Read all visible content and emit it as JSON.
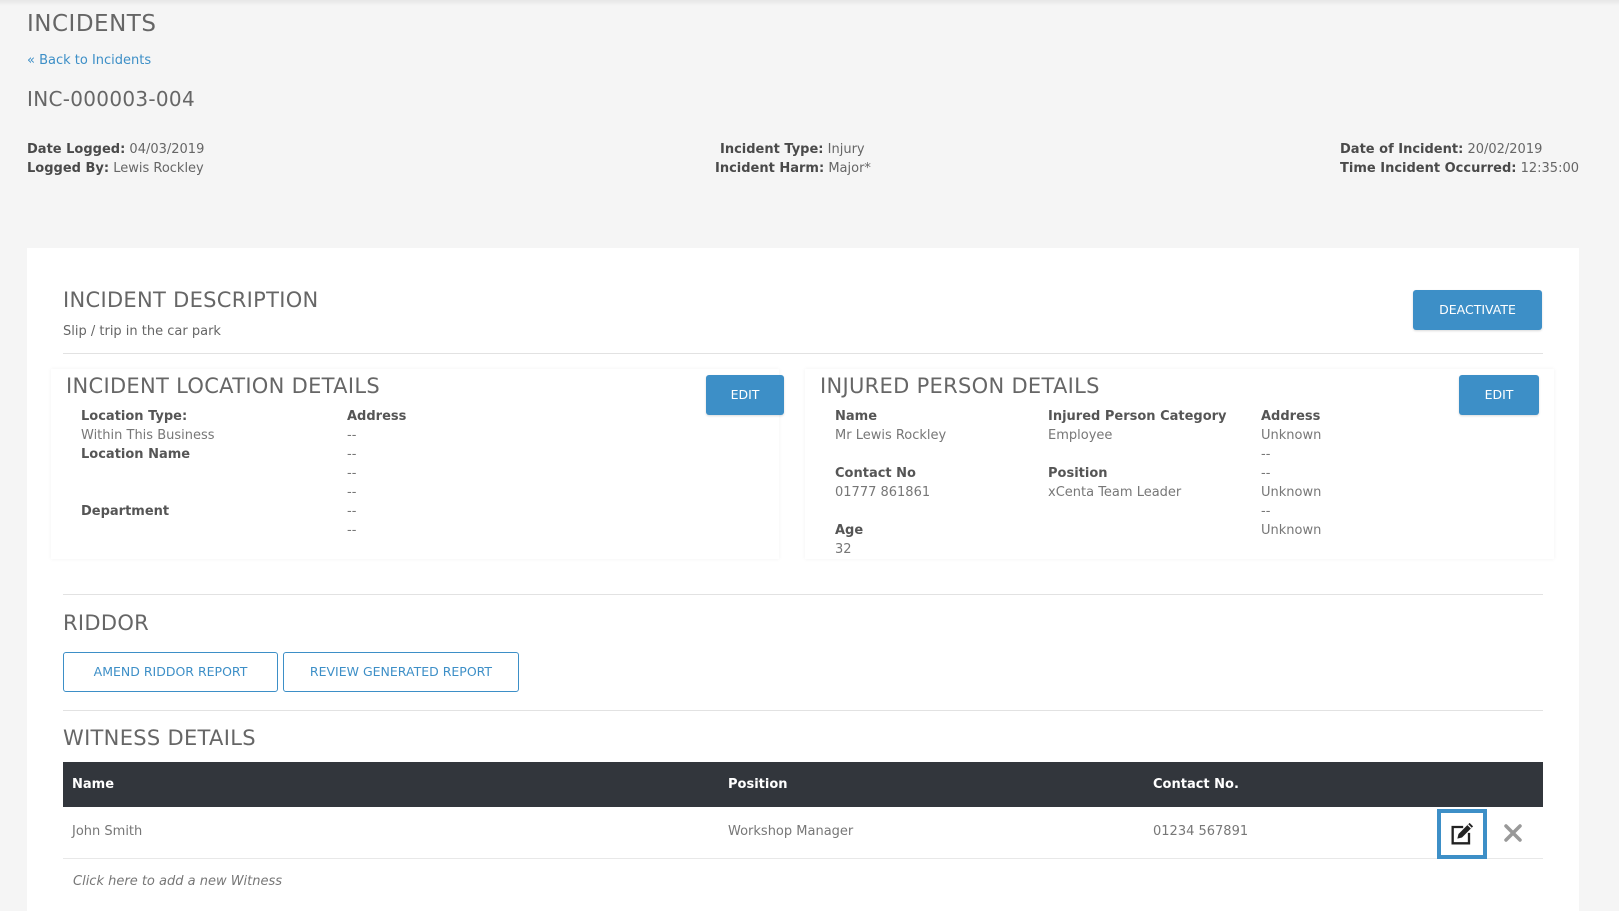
{
  "page": {
    "title": "INCIDENTS",
    "back_link": "« Back to Incidents",
    "incident_id": "INC-000003-004"
  },
  "meta": {
    "date_logged_label": "Date Logged:",
    "date_logged": "04/03/2019",
    "logged_by_label": "Logged By:",
    "logged_by": "Lewis Rockley",
    "incident_type_label": "Incident Type:",
    "incident_type": "Injury",
    "incident_harm_label": "Incident Harm:",
    "incident_harm": "Major*",
    "date_of_incident_label": "Date of Incident:",
    "date_of_incident": "20/02/2019",
    "time_occurred_label": "Time Incident Occurred:",
    "time_occurred": "12:35:00"
  },
  "description": {
    "heading": "INCIDENT DESCRIPTION",
    "text": "Slip / trip in the car park",
    "deactivate_label": "DEACTIVATE"
  },
  "location": {
    "heading": "INCIDENT LOCATION DETAILS",
    "edit_label": "EDIT",
    "location_type_label": "Location Type:",
    "location_type": "Within This Business",
    "location_name_label": "Location Name",
    "department_label": "Department",
    "address_label": "Address",
    "address_lines": [
      "--",
      "--",
      "--",
      "--",
      "--",
      "--"
    ]
  },
  "injured": {
    "heading": "INJURED PERSON DETAILS",
    "edit_label": "EDIT",
    "name_label": "Name",
    "name": "Mr Lewis Rockley",
    "contact_label": "Contact No",
    "contact": "01777 861861",
    "age_label": "Age",
    "age": "32",
    "category_label": "Injured Person Category",
    "category": "Employee",
    "position_label": "Position",
    "position": "xCenta Team Leader",
    "address_label": "Address",
    "address_lines": [
      "Unknown",
      "--",
      "--",
      "Unknown",
      "--",
      "Unknown"
    ]
  },
  "riddor": {
    "heading": "RIDDOR",
    "amend_label": "AMEND RIDDOR REPORT",
    "review_label": "REVIEW GENERATED REPORT"
  },
  "witness": {
    "heading": "WITNESS DETAILS",
    "columns": [
      "Name",
      "Position",
      "Contact No."
    ],
    "rows": [
      {
        "name": "John Smith",
        "position": "Workshop Manager",
        "contact": "01234 567891"
      }
    ],
    "add_text": "Click here to add a new Witness"
  },
  "colors": {
    "accent": "#3d8fc7",
    "table_header": "#32363c",
    "background": "#f5f5f5"
  },
  "icons": [
    "edit-icon",
    "close-icon"
  ]
}
